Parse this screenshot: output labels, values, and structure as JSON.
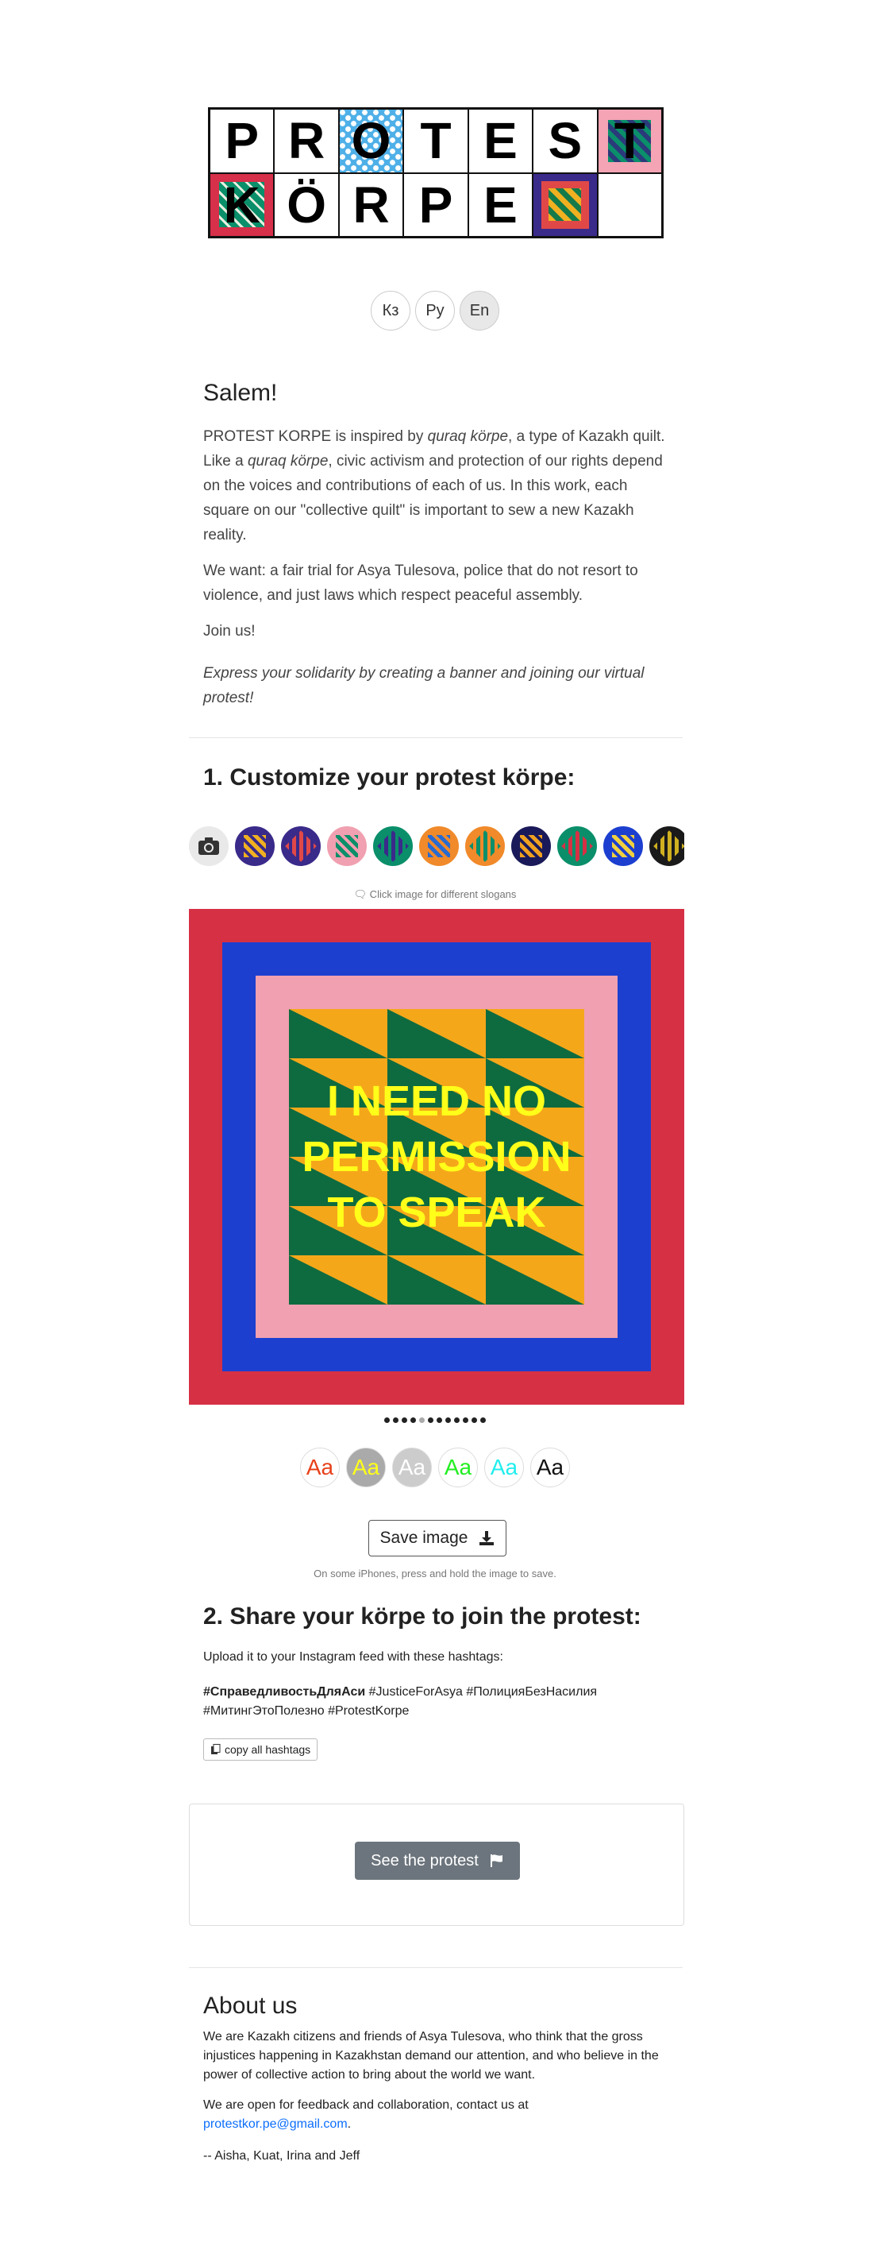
{
  "logo": {
    "row1": [
      "P",
      "R",
      "O",
      "T",
      "E",
      "S",
      "T"
    ],
    "row2": [
      "K",
      "Ö",
      "R",
      "P",
      "E",
      ""
    ]
  },
  "languages": [
    {
      "label": "Кз",
      "active": false
    },
    {
      "label": "Ру",
      "active": false
    },
    {
      "label": "En",
      "active": true
    }
  ],
  "intro": {
    "greeting": "Salem!",
    "p1_a": "PROTEST KORPE is inspired by ",
    "p1_em1": "quraq körpe",
    "p1_b": ", a type of Kazakh quilt. Like a ",
    "p1_em2": "quraq körpe",
    "p1_c": ", civic activism and protection of our rights depend on the voices and contributions of each of us. In this work, each square on our \"collective quilt\" is important to sew a new Kazakh reality.",
    "p2": "We want: a fair trial for Asya Tulesova, police that do not resort to violence, and just laws which respect peaceful assembly.",
    "p3": "Join us!",
    "p4": "Express your solidarity by creating a banner and joining our virtual protest!"
  },
  "step1": {
    "title": "1. Customize your protest körpe:",
    "hint": "🗨 Click image for different slogans",
    "slogan": "I NEED NO PERMISSION TO SPEAK",
    "quilt_colors": {
      "outer": "#d63045",
      "blue": "#1c3fd0",
      "pink": "#f0a0b0",
      "yellow": "#f5a71a",
      "green": "#0e6b3f",
      "slogan": "#ffff1a"
    },
    "quilt_options": [
      {
        "name": "quilt-option-1",
        "bg": "#3a2a8a",
        "fg": "#f0b020"
      },
      {
        "name": "quilt-option-2",
        "bg": "#3a2a8a",
        "fg": "#e04848"
      },
      {
        "name": "quilt-option-3",
        "bg": "#f0a0b0",
        "fg": "#0a8f6a"
      },
      {
        "name": "quilt-option-4",
        "bg": "#0a8f6a",
        "fg": "#3a2a8a"
      },
      {
        "name": "quilt-option-5",
        "bg": "#f08a2a",
        "fg": "#2a6ad0"
      },
      {
        "name": "quilt-option-6",
        "bg": "#f08a2a",
        "fg": "#0a8f6a"
      },
      {
        "name": "quilt-option-7",
        "bg": "#1a1a5a",
        "fg": "#f0a020"
      },
      {
        "name": "quilt-option-8",
        "bg": "#0a8f6a",
        "fg": "#d63045"
      },
      {
        "name": "quilt-option-9",
        "bg": "#1c3fd0",
        "fg": "#f0d040"
      },
      {
        "name": "quilt-option-10",
        "bg": "#1a1a1a",
        "fg": "#d0b020"
      }
    ],
    "slide_count": 12,
    "active_slide": 4,
    "font_colors": [
      {
        "label": "Aa",
        "color": "#e8401a",
        "bg": "#ffffff"
      },
      {
        "label": "Aa",
        "color": "#ffff1a",
        "bg": "#aaaaaa"
      },
      {
        "label": "Aa",
        "color": "#ffffff",
        "bg": "#cccccc"
      },
      {
        "label": "Aa",
        "color": "#22ee22",
        "bg": "#ffffff"
      },
      {
        "label": "Aa",
        "color": "#22eeee",
        "bg": "#ffffff"
      },
      {
        "label": "Aa",
        "color": "#111111",
        "bg": "#ffffff"
      }
    ],
    "save_label": "Save image",
    "save_note": "On some iPhones, press and hold the image to save."
  },
  "step2": {
    "title": "2. Share your körpe to join the protest:",
    "instruction": "Upload it to your Instagram feed with these hashtags:",
    "hashtag_bold": "#СправедливостьДляАси",
    "hashtags_rest": " #JusticeForAsya #ПолицияБезНасилия #МитингЭтоПолезно #ProtestKorpe",
    "copy_label": "copy all hashtags",
    "see_label": "See the protest"
  },
  "about": {
    "title": "About us",
    "p1": "We are Kazakh citizens and friends of Asya Tulesova, who think that the gross injustices happening in Kazakhstan demand our attention, and who believe in the power of collective action to bring about the world we want.",
    "p2_a": "We are open for feedback and collaboration, contact us at ",
    "email": "protestkor.pe@gmail.com",
    "p2_b": ".",
    "signature": "-- Aisha, Kuat, Irina and Jeff"
  }
}
